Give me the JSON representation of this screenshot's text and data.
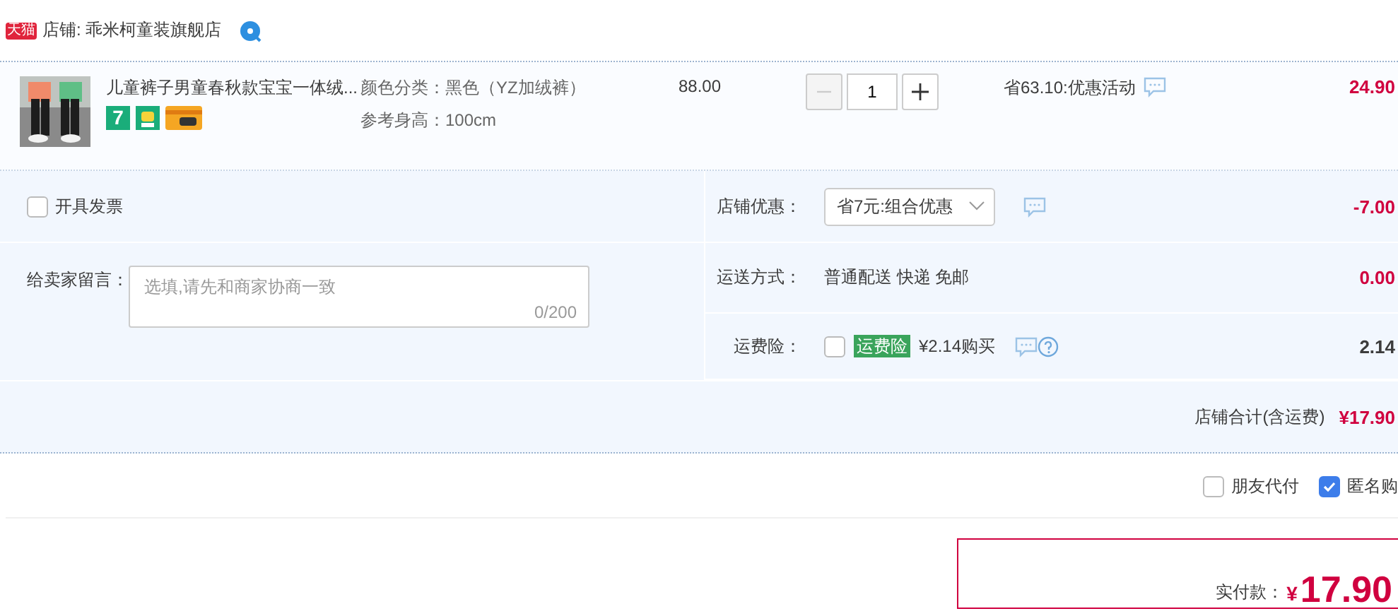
{
  "store": {
    "badge": "天猫",
    "name": "店铺: 乖米柯童装旗舰店"
  },
  "item": {
    "title": "儿童裤子男童春秋款宝宝一体绒...",
    "badges": [
      {
        "kind": "number",
        "text": "7"
      },
      {
        "kind": "robot"
      },
      {
        "kind": "card"
      }
    ],
    "attributes": [
      "颜色分类：黑色（YZ加绒裤）",
      "参考身高：100cm"
    ],
    "price": "88.00",
    "quantity": "1",
    "decrease_disabled": true,
    "promo": "省63.10:优惠活动",
    "subtotal": "24.90"
  },
  "invoice": {
    "label": "开具发票",
    "checked": false
  },
  "message": {
    "label": "给卖家留言：",
    "placeholder": "选填,请先和商家协商一致",
    "counter": "0/200"
  },
  "rows": [
    {
      "kind": "select",
      "label": "店铺优惠：",
      "value": "省7元:组合优惠",
      "amount": "-7.00",
      "highlight": true
    },
    {
      "kind": "text",
      "label": "运送方式：",
      "value": "普通配送 快递 免邮",
      "amount": "0.00",
      "highlight": true
    },
    {
      "kind": "insurance",
      "label": "运费险：",
      "checked": false,
      "tag": "运费险",
      "value": "¥2.14购买",
      "amount": "2.14",
      "highlight": false
    }
  ],
  "store_total": {
    "label": "店铺合计(含运费)",
    "amount": "¥17.90"
  },
  "footer_options": [
    {
      "label": "朋友代付",
      "checked": false
    },
    {
      "label": "匿名购",
      "checked": true
    }
  ],
  "payment": {
    "label": "实付款：",
    "currency": "¥",
    "amount": "17.90"
  }
}
